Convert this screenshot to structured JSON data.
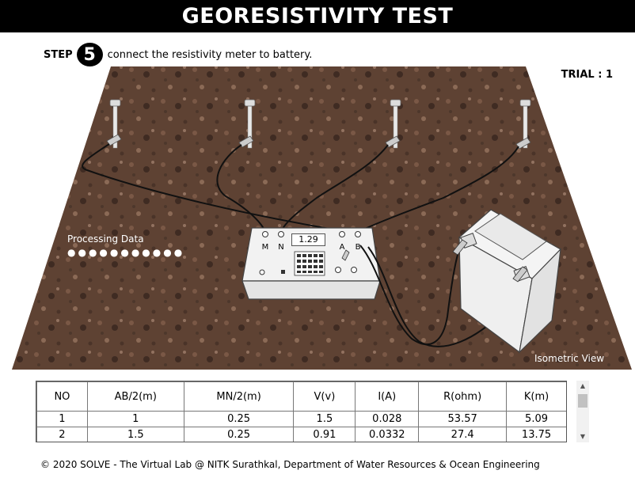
{
  "header": {
    "title": "GEORESISTIVITY TEST"
  },
  "step": {
    "label": "STEP",
    "number": "5",
    "instruction": "connect the resistivity meter to battery."
  },
  "trial": {
    "label": "TRIAL : 1"
  },
  "scene": {
    "processing_label": "Processing Data",
    "processing_dots": "●●●●●●●●●●●",
    "view_label": "Isometric View",
    "meter": {
      "reading": "1.29",
      "terminal_m": "M",
      "terminal_n": "N",
      "terminal_a": "A",
      "terminal_b": "B"
    }
  },
  "table": {
    "headers": [
      "NO",
      "AB/2(m)",
      "MN/2(m)",
      "V(v)",
      "I(A)",
      "R(ohm)",
      "K(m)"
    ],
    "rows": [
      [
        "1",
        "1",
        "0.25",
        "1.5",
        "0.028",
        "53.57",
        "5.09"
      ],
      [
        "2",
        "1.5",
        "0.25",
        "0.91",
        "0.0332",
        "27.4",
        "13.75"
      ]
    ]
  },
  "footer": {
    "text": "© 2020 SOLVE - The Virtual Lab @ NITK Surathkal, Department of Water Resources & Ocean Engineering"
  },
  "colors": {
    "soil_dark": "#4a3327",
    "soil_mid": "#6b4c3b",
    "soil_light": "#8a6a57",
    "header_bg": "#000000"
  }
}
